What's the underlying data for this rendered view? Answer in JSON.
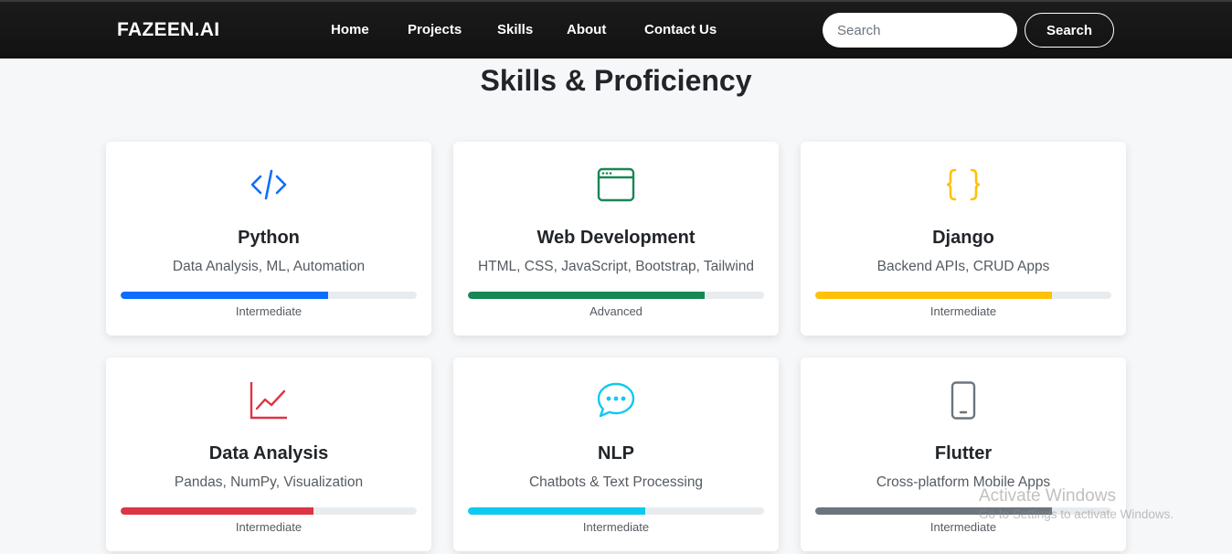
{
  "nav": {
    "brand": "FAZEEN.AI",
    "links": [
      "Home",
      "Projects",
      "Skills",
      "About",
      "Contact Us"
    ],
    "search_placeholder": "Search",
    "search_button": "Search"
  },
  "section_title": "Skills & Proficiency",
  "skills": [
    {
      "title": "Python",
      "description": "Data Analysis, ML, Automation",
      "level": "Intermediate",
      "progress": 0.7,
      "color": "#0d6efd",
      "icon": "code-icon"
    },
    {
      "title": "Web Development",
      "description": "HTML, CSS, JavaScript, Bootstrap, Tailwind",
      "level": "Advanced",
      "progress": 0.8,
      "color": "#198754",
      "icon": "browser-window-icon"
    },
    {
      "title": "Django",
      "description": "Backend APIs, CRUD Apps",
      "level": "Intermediate",
      "progress": 0.8,
      "color": "#ffc107",
      "icon": "braces-icon"
    },
    {
      "title": "Data Analysis",
      "description": "Pandas, NumPy, Visualization",
      "level": "Intermediate",
      "progress": 0.65,
      "color": "#dc3545",
      "icon": "line-chart-icon"
    },
    {
      "title": "NLP",
      "description": "Chatbots & Text Processing",
      "level": "Intermediate",
      "progress": 0.6,
      "color": "#0dcaf0",
      "icon": "chat-dots-icon"
    },
    {
      "title": "Flutter",
      "description": "Cross-platform Mobile Apps",
      "level": "Intermediate",
      "progress": 0.8,
      "color": "#6c757d",
      "icon": "phone-icon"
    }
  ],
  "watermark": {
    "title": "Activate Windows",
    "subtitle": "Go to Settings to activate Windows."
  }
}
